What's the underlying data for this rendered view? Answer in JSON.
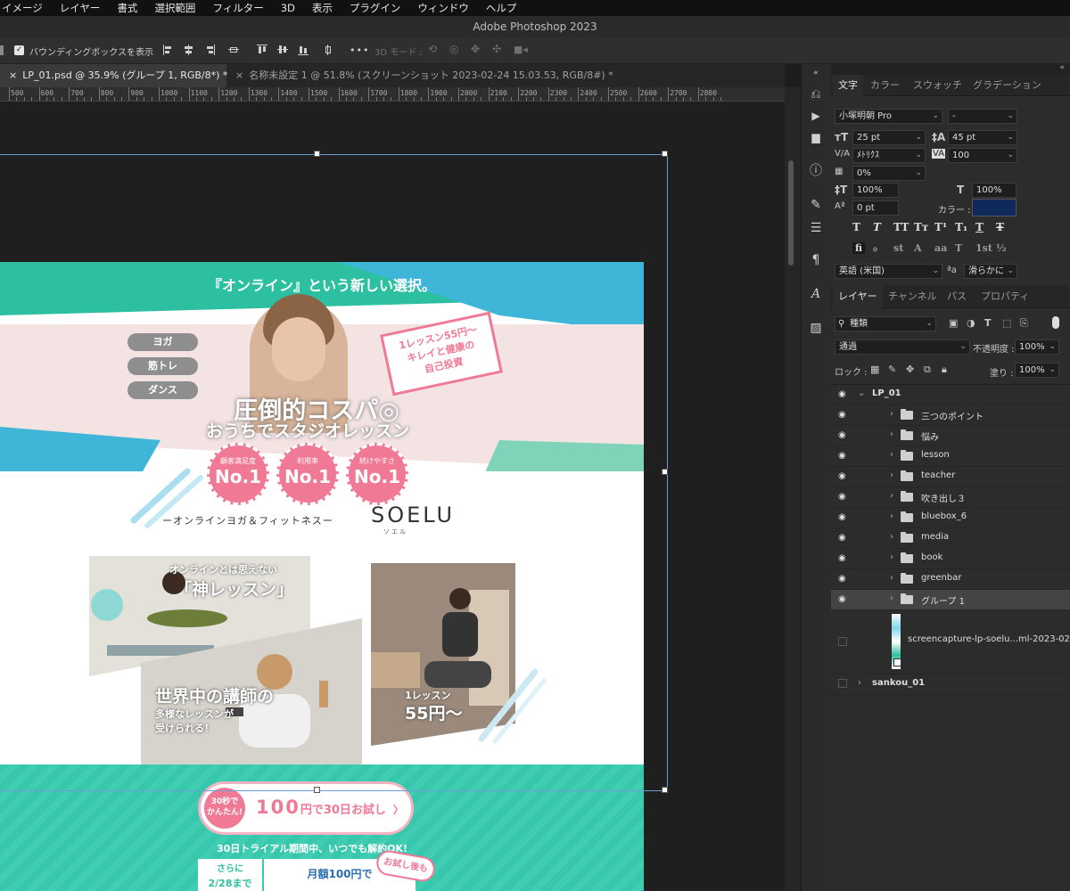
{
  "menubar": {
    "items": [
      "イメージ",
      "レイヤー",
      "書式",
      "選択範囲",
      "フィルター",
      "3D",
      "表示",
      "プラグイン",
      "ウィンドウ",
      "ヘルプ"
    ]
  },
  "window": {
    "title": "Adobe Photoshop 2023"
  },
  "options": {
    "show_bbox_label": "バウンディングボックスを表示",
    "mode_3d_label": "3D モード :",
    "more": "•••"
  },
  "tabs": [
    {
      "label": "LP_01.psd @ 35.9% (グループ 1, RGB/8*) *",
      "close": "×"
    },
    {
      "label": "名称未設定 1 @ 51.8% (スクリーンショット 2023-02-24 15.03.53, RGB/8#) *",
      "close": "×"
    }
  ],
  "ruler": {
    "labels": [
      "500",
      "600",
      "700",
      "800",
      "900",
      "1000",
      "1100",
      "1200",
      "1300",
      "1400",
      "1500",
      "1600",
      "1700",
      "1800",
      "1900",
      "2000",
      "2100",
      "2200",
      "2300",
      "2400",
      "2500",
      "2600",
      "2700",
      "2800"
    ]
  },
  "lp": {
    "headline": "『オンライン』という新しい選択。",
    "tags": [
      "ヨガ",
      "筋トレ",
      "ダンス"
    ],
    "bubble": [
      "1レッスン55円〜",
      "キレイと健康の",
      "自己投資"
    ],
    "hero_title": "圧倒的コスパ◎",
    "hero_sub": "おうちでスタジオレッスン",
    "badges": [
      {
        "top": "顧客満足度",
        "main": "No.1"
      },
      {
        "top": "利用率",
        "main": "No.1"
      },
      {
        "top": "続けやすさ",
        "main": "No.1"
      }
    ],
    "tagline": "ーオンラインヨガ＆フィットネスー",
    "brand": "SOELU",
    "brand_kana": "ソエル",
    "photo1_small": "オンラインとは思えない",
    "photo1_big": "「神レッスン」",
    "photo2_big": "世界中の講師の",
    "photo2_small": [
      "多様なレッスンが",
      "受けられる！"
    ],
    "photo3_small": "1レッスン",
    "photo3_big": "55円〜",
    "cta_left": [
      "30秒で",
      "かんたん!"
    ],
    "cta_price": "100",
    "cta_text": "円で30日お試し",
    "cta_arrow": "〉",
    "trial_note": "30日トライアル期間中、いつでも解約OK!",
    "bottom_left": [
      "さらに",
      "2/28まで"
    ],
    "bottom_mid": [
      "月額100円で"
    ],
    "bottom_tag": "お試し後も"
  },
  "colors": {
    "teal": "#2cc0a0",
    "blue": "#3fb6d8",
    "pink": "#f07a95",
    "font_color": "#0f2a5a"
  },
  "char_panel": {
    "tabs": [
      "文字",
      "カラー",
      "スウォッチ",
      "グラデーション"
    ],
    "font_family": "小塚明朝 Pro",
    "font_style": "-",
    "size": "25 pt",
    "leading": "45 pt",
    "kerning": "ﾒﾄﾘｸｽ",
    "tracking": "100",
    "tsume": "0%",
    "vscale": "100%",
    "hscale": "100%",
    "baseline": "0 pt",
    "color_label": "カラー :",
    "style_buttons": [
      "T",
      "T",
      "TT",
      "Tт",
      "T¹",
      "T₁",
      "T",
      "Ŧ"
    ],
    "ot_buttons": [
      "fi",
      "ℴ",
      "st",
      "A",
      "aa",
      "T",
      "1st",
      "½"
    ],
    "language": "英語 (米国)",
    "aa_label": "ªa",
    "antialias": "滑らかに"
  },
  "layers_panel": {
    "tabs": [
      "レイヤー",
      "チャンネル",
      "パス",
      "プロパティ"
    ],
    "filter": "種類",
    "blend": "通過",
    "opacity_label": "不透明度 :",
    "opacity": "100%",
    "lock_label": "ロック :",
    "fill_label": "塗り :",
    "fill": "100%",
    "layers": [
      {
        "name": "LP_01",
        "type": "group-open",
        "visible": true
      },
      {
        "name": "三つのポイント",
        "type": "folder",
        "visible": true
      },
      {
        "name": "悩み",
        "type": "folder",
        "visible": true
      },
      {
        "name": "lesson",
        "type": "folder",
        "visible": true
      },
      {
        "name": "teacher",
        "type": "folder",
        "visible": true
      },
      {
        "name": "吹き出し３",
        "type": "folder",
        "visible": true
      },
      {
        "name": "bluebox_6",
        "type": "folder",
        "visible": true
      },
      {
        "name": "media",
        "type": "folder",
        "visible": true
      },
      {
        "name": "book",
        "type": "folder",
        "visible": true
      },
      {
        "name": "greenbar",
        "type": "folder",
        "visible": true
      },
      {
        "name": "グループ 1",
        "type": "folder",
        "visible": true,
        "selected": true
      },
      {
        "name": "screencapture-lp-soelu...ml-2023-02-",
        "type": "image",
        "visible": false
      },
      {
        "name": "sankou_01",
        "type": "group",
        "visible": false
      }
    ]
  },
  "toolstrip_icons": [
    "history-icon",
    "play-icon",
    "comment-icon",
    "info-icon",
    "brush-icon",
    "sliders-icon",
    "paragraph-icon",
    "glyph-icon",
    "image-update-icon"
  ]
}
